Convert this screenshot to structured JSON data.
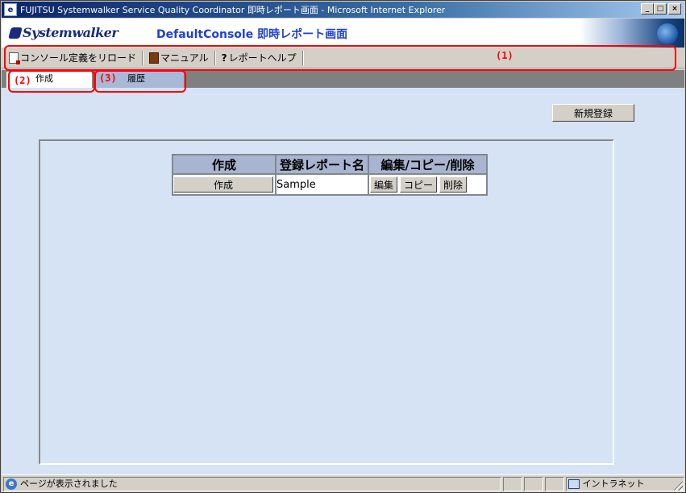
{
  "window": {
    "title": "FUJITSU Systemwalker Service Quality Coordinator 即時レポート画面 - Microsoft Internet Explorer",
    "minimize": "_",
    "maximize": "□",
    "close": "×"
  },
  "banner": {
    "logo": "Systemwalker",
    "console_title": "DefaultConsole 即時レポート画面"
  },
  "toolbar": {
    "reload_label": "コンソール定義をリロード",
    "manual_label": "マニュアル",
    "help_label": "レポートヘルプ"
  },
  "tabs": {
    "create": "作成",
    "history": "履歴"
  },
  "annotations": {
    "toolbar": "(1)",
    "create_tab": "(2)",
    "history_tab": "(3)"
  },
  "content": {
    "new_register_button": "新規登録",
    "table": {
      "headers": [
        "作成",
        "登録レポート名",
        "編集/コピー/削除"
      ],
      "rows": [
        {
          "create_button": "作成",
          "name": "Sample",
          "edit": "編集",
          "copy": "コピー",
          "delete": "削除"
        }
      ]
    }
  },
  "statusbar": {
    "message": "ページが表示されました",
    "zone": "イントラネット"
  },
  "icons": [
    "ie-window-icon",
    "reload-icon",
    "manual-book-icon",
    "help-icon",
    "ie-page-icon",
    "intranet-zone-icon"
  ],
  "colors": {
    "annotation": "#ff0000",
    "content_bg": "#d6e3f4",
    "title_blue": "#1d40d8"
  }
}
